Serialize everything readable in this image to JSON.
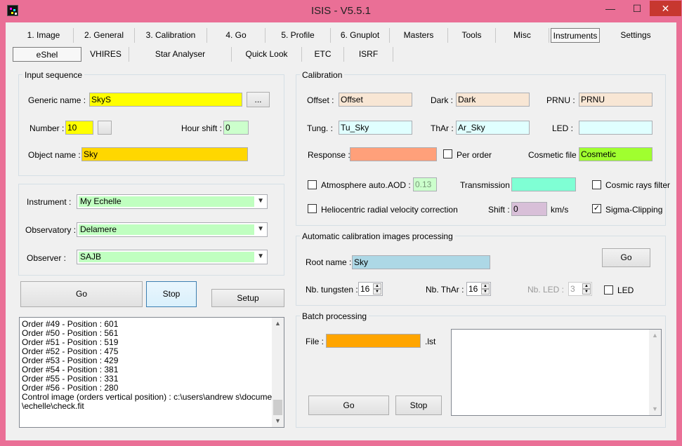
{
  "window": {
    "title": "ISIS - V5.5.1",
    "min": "—",
    "max": "☐",
    "close": "✕"
  },
  "tabs": [
    "1. Image",
    "2. General",
    "3. Calibration",
    "4. Go",
    "5. Profile",
    "6. Gnuplot",
    "Masters",
    "Tools",
    "Misc",
    "Instruments",
    "Settings"
  ],
  "subtabs": [
    "eShel",
    "VHIRES",
    "Star Analyser",
    "Quick Look",
    "ETC",
    "ISRF"
  ],
  "input_sequence": {
    "title": "Input sequence",
    "generic_name_label": "Generic name :",
    "generic_name": "SkyS",
    "browse": "...",
    "number_label": "Number :",
    "number": "10",
    "hour_shift_label": "Hour shift :",
    "hour_shift": "0",
    "object_name_label": "Object name :",
    "object_name": "Sky"
  },
  "observation": {
    "instrument_label": "Instrument :",
    "instrument": "My Echelle",
    "observatory_label": "Observatory :",
    "observatory": "Delamere",
    "observer_label": "Observer :",
    "observer": "SAJB"
  },
  "actions": {
    "go": "Go",
    "stop": "Stop",
    "setup": "Setup"
  },
  "log_lines": [
    "Order #49 - Position : 601",
    "Order #50 - Position : 561",
    "Order #51 - Position : 519",
    "Order #52 - Position : 475",
    "Order #53 - Position : 429",
    "Order #54 - Position : 381",
    "Order #55 - Position : 331",
    "Order #56 - Position : 280",
    "Control image (orders vertical position) : c:\\users\\andrew s\\documents",
    "\\echelle\\check.fit"
  ],
  "calibration": {
    "title": "Calibration",
    "offset_label": "Offset :",
    "offset": "Offset",
    "dark_label": "Dark :",
    "dark": "Dark",
    "prnu_label": "PRNU :",
    "prnu": "PRNU",
    "tung_label": "Tung. :",
    "tung": "Tu_Sky",
    "thar_label": "ThAr :",
    "thar": "Ar_Sky",
    "led_label": "LED :",
    "led": "",
    "response_label": "Response :",
    "response": "",
    "per_order_label": "Per order",
    "cosmetic_label": "Cosmetic file :",
    "cosmetic": "Cosmetic",
    "atmosphere_label": "Atmosphere auto.",
    "aod_label": "AOD :",
    "aod": "0.13",
    "transmission_label": "Transmission :",
    "transmission": "",
    "cosmic_rays_label": "Cosmic rays filter",
    "helio_label": "Heliocentric radial velocity correction",
    "shift_label": "Shift :",
    "shift": "0",
    "shift_unit": "km/s",
    "sigma_label": "Sigma-Clipping",
    "sigma_check": "✓"
  },
  "auto_calib": {
    "title": "Automatic calibration images processing",
    "root_label": "Root name :",
    "root": "Sky",
    "go": "Go",
    "nb_tungsten_label": "Nb. tungsten :",
    "nb_tungsten": "16",
    "nb_thar_label": "Nb. ThAr :",
    "nb_thar": "16",
    "nb_led_label": "Nb. LED :",
    "nb_led": "3",
    "led_label": "LED"
  },
  "batch": {
    "title": "Batch processing",
    "file_label": "File :",
    "file": "",
    "ext": ".lst",
    "go": "Go",
    "stop": "Stop"
  },
  "colors": {
    "yellow": "#ffff00",
    "gold": "#ffd700",
    "pale_green": "#ccffcc",
    "light_green": "#c0ffc0",
    "peach": "#f8e6d4",
    "light_cyan": "#e0ffff",
    "salmon": "#ffa07a",
    "lawn_green": "#a0ff2f",
    "aquamarine": "#7fffd4",
    "thistle": "#d8bfd8",
    "light_blue": "#add8e6",
    "orange": "#ffa500"
  }
}
